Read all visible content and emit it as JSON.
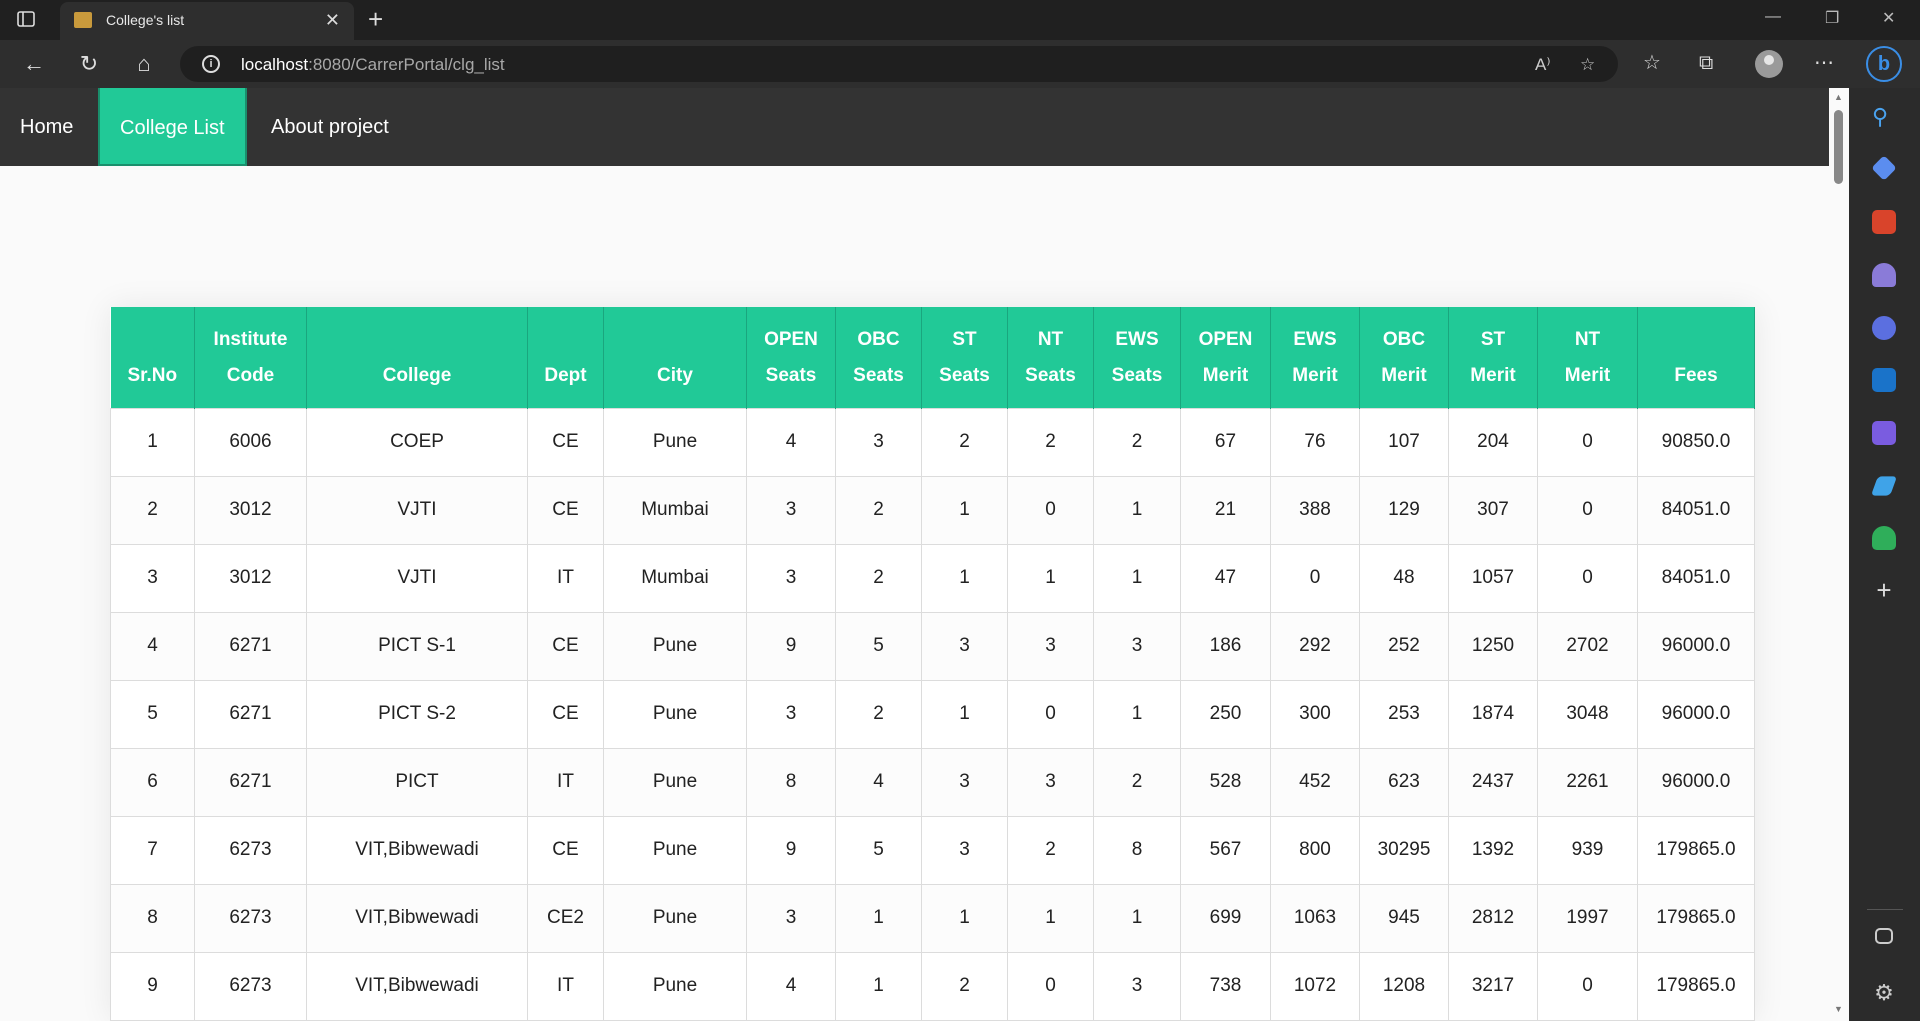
{
  "browser": {
    "tab_title": "College's list",
    "url_host": "localhost",
    "url_rest": ":8080/CarrerPortal/clg_list"
  },
  "nav": {
    "home": "Home",
    "college_list": "College List",
    "about": "About project"
  },
  "table": {
    "headers": [
      [
        "",
        "Sr.No"
      ],
      [
        "Institute",
        "Code"
      ],
      [
        "",
        "College"
      ],
      [
        "",
        "Dept"
      ],
      [
        "",
        "City"
      ],
      [
        "OPEN",
        "Seats"
      ],
      [
        "OBC",
        "Seats"
      ],
      [
        "ST",
        "Seats"
      ],
      [
        "NT",
        "Seats"
      ],
      [
        "EWS",
        "Seats"
      ],
      [
        "OPEN",
        "Merit"
      ],
      [
        "EWS",
        "Merit"
      ],
      [
        "OBC",
        "Merit"
      ],
      [
        "ST",
        "Merit"
      ],
      [
        "NT",
        "Merit"
      ],
      [
        "",
        "Fees"
      ]
    ],
    "rows": [
      [
        "1",
        "6006",
        "COEP",
        "CE",
        "Pune",
        "4",
        "3",
        "2",
        "2",
        "2",
        "67",
        "76",
        "107",
        "204",
        "0",
        "90850.0"
      ],
      [
        "2",
        "3012",
        "VJTI",
        "CE",
        "Mumbai",
        "3",
        "2",
        "1",
        "0",
        "1",
        "21",
        "388",
        "129",
        "307",
        "0",
        "84051.0"
      ],
      [
        "3",
        "3012",
        "VJTI",
        "IT",
        "Mumbai",
        "3",
        "2",
        "1",
        "1",
        "1",
        "47",
        "0",
        "48",
        "1057",
        "0",
        "84051.0"
      ],
      [
        "4",
        "6271",
        "PICT S-1",
        "CE",
        "Pune",
        "9",
        "5",
        "3",
        "3",
        "3",
        "186",
        "292",
        "252",
        "1250",
        "2702",
        "96000.0"
      ],
      [
        "5",
        "6271",
        "PICT S-2",
        "CE",
        "Pune",
        "3",
        "2",
        "1",
        "0",
        "1",
        "250",
        "300",
        "253",
        "1874",
        "3048",
        "96000.0"
      ],
      [
        "6",
        "6271",
        "PICT",
        "IT",
        "Pune",
        "8",
        "4",
        "3",
        "3",
        "2",
        "528",
        "452",
        "623",
        "2437",
        "2261",
        "96000.0"
      ],
      [
        "7",
        "6273",
        "VIT,Bibwewadi",
        "CE",
        "Pune",
        "9",
        "5",
        "3",
        "2",
        "8",
        "567",
        "800",
        "30295",
        "1392",
        "939",
        "179865.0"
      ],
      [
        "8",
        "6273",
        "VIT,Bibwewadi",
        "CE2",
        "Pune",
        "3",
        "1",
        "1",
        "1",
        "1",
        "699",
        "1063",
        "945",
        "2812",
        "1997",
        "179865.0"
      ],
      [
        "9",
        "6273",
        "VIT,Bibwewadi",
        "IT",
        "Pune",
        "4",
        "1",
        "2",
        "0",
        "3",
        "738",
        "1072",
        "1208",
        "3217",
        "0",
        "179865.0"
      ]
    ]
  },
  "colors": {
    "accent": "#21c997",
    "navbar": "#333333",
    "page_bg": "#fafafa"
  }
}
